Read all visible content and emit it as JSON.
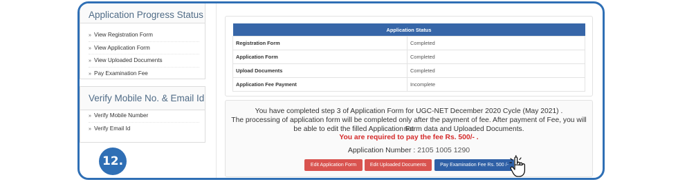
{
  "sidebar": {
    "progress_title": "Application Progress Status",
    "progress_items": [
      "View Registration Form",
      "View Application Form",
      "View Uploaded Documents",
      "Pay Examination Fee"
    ],
    "verify_title": "Verify Mobile No. & Email Id",
    "verify_items": [
      "Verify Mobile Number",
      "Verify Email Id"
    ]
  },
  "status_table": {
    "header": "Application Status",
    "rows": [
      {
        "label": "Registration Form",
        "value": "Completed"
      },
      {
        "label": "Application Form",
        "value": "Completed"
      },
      {
        "label": "Upload Documents",
        "value": "Completed"
      },
      {
        "label": "Application Fee Payment",
        "value": "Incomplete"
      }
    ]
  },
  "message": {
    "line1": "You have completed step 3 of Application Form for UGC-NET December 2020 Cycle (May 2021) .",
    "line2": "The processing of application form will be completed only after the payment of fee. After payment of Fee, you will not",
    "line3": "be able to edit the filled Application Form data and Uploaded Documents.",
    "fee_notice": "You are required to pay the fee Rs. 500/- .",
    "app_number_label": "Application Number :",
    "app_number": "2105 1005 1290"
  },
  "buttons": {
    "edit_form": "Edit Application Form",
    "edit_docs": "Edit Uploaded Documents",
    "pay_fee": "Pay Examination Fee Rs. 500 /-"
  },
  "step_badge": "12.",
  "colors": {
    "frame": "#2f6fb5",
    "table_header": "#3766a8",
    "fee_text": "#d42a2a",
    "red_button": "#d9534f",
    "blue_button": "#2f60a6"
  }
}
